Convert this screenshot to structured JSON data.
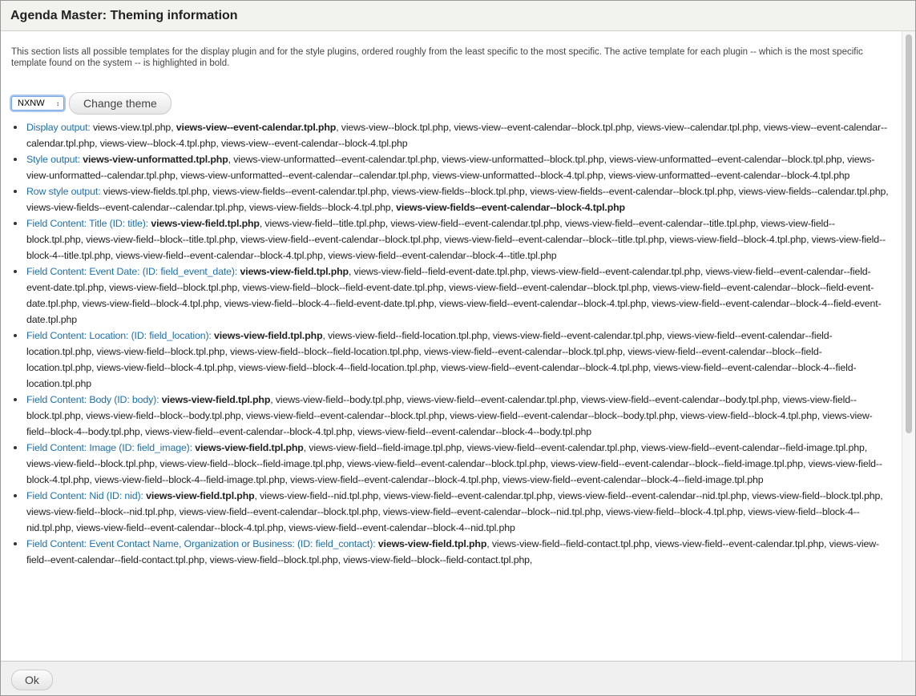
{
  "window": {
    "title": "Agenda Master: Theming information"
  },
  "description": "This section lists all possible templates for the display plugin and for the style plugins, ordered roughly from the least specific to the most specific. The active template for each plugin -- which is the most specific template found on the system -- is highlighted in bold.",
  "theme_select": {
    "value": "NXNW"
  },
  "change_theme_label": "Change theme",
  "ok_label": "Ok",
  "colors": {
    "link": "#1a6fb5",
    "titlebar": "#f2f2ee"
  },
  "items": [
    {
      "label": "Display output:",
      "templates": [
        {
          "name": "views-view.tpl.php"
        },
        {
          "name": "views-view--event-calendar.tpl.php",
          "active": true
        },
        {
          "name": "views-view--block.tpl.php"
        },
        {
          "name": "views-view--event-calendar--block.tpl.php"
        },
        {
          "name": "views-view--calendar.tpl.php"
        },
        {
          "name": "views-view--event-calendar--calendar.tpl.php"
        },
        {
          "name": "views-view--block-4.tpl.php"
        },
        {
          "name": "views-view--event-calendar--block-4.tpl.php"
        }
      ]
    },
    {
      "label": "Style output:",
      "templates": [
        {
          "name": "views-view-unformatted.tpl.php",
          "active": true
        },
        {
          "name": "views-view-unformatted--event-calendar.tpl.php"
        },
        {
          "name": "views-view-unformatted--block.tpl.php"
        },
        {
          "name": "views-view-unformatted--event-calendar--block.tpl.php"
        },
        {
          "name": "views-view-unformatted--calendar.tpl.php"
        },
        {
          "name": "views-view-unformatted--event-calendar--calendar.tpl.php"
        },
        {
          "name": "views-view-unformatted--block-4.tpl.php"
        },
        {
          "name": "views-view-unformatted--event-calendar--block-4.tpl.php"
        }
      ]
    },
    {
      "label": "Row style output:",
      "templates": [
        {
          "name": "views-view-fields.tpl.php"
        },
        {
          "name": "views-view-fields--event-calendar.tpl.php"
        },
        {
          "name": "views-view-fields--block.tpl.php"
        },
        {
          "name": "views-view-fields--event-calendar--block.tpl.php"
        },
        {
          "name": "views-view-fields--calendar.tpl.php"
        },
        {
          "name": "views-view-fields--event-calendar--calendar.tpl.php"
        },
        {
          "name": "views-view-fields--block-4.tpl.php"
        },
        {
          "name": "views-view-fields--event-calendar--block-4.tpl.php",
          "active": true
        }
      ]
    },
    {
      "label": "Field Content: Title (ID: title):",
      "templates": [
        {
          "name": "views-view-field.tpl.php",
          "active": true
        },
        {
          "name": "views-view-field--title.tpl.php"
        },
        {
          "name": "views-view-field--event-calendar.tpl.php"
        },
        {
          "name": "views-view-field--event-calendar--title.tpl.php"
        },
        {
          "name": "views-view-field--block.tpl.php"
        },
        {
          "name": "views-view-field--block--title.tpl.php"
        },
        {
          "name": "views-view-field--event-calendar--block.tpl.php"
        },
        {
          "name": "views-view-field--event-calendar--block--title.tpl.php"
        },
        {
          "name": "views-view-field--block-4.tpl.php"
        },
        {
          "name": "views-view-field--block-4--title.tpl.php"
        },
        {
          "name": "views-view-field--event-calendar--block-4.tpl.php"
        },
        {
          "name": "views-view-field--event-calendar--block-4--title.tpl.php"
        }
      ]
    },
    {
      "label": "Field Content: Event Date: (ID: field_event_date):",
      "templates": [
        {
          "name": "views-view-field.tpl.php",
          "active": true
        },
        {
          "name": "views-view-field--field-event-date.tpl.php"
        },
        {
          "name": "views-view-field--event-calendar.tpl.php"
        },
        {
          "name": "views-view-field--event-calendar--field-event-date.tpl.php"
        },
        {
          "name": "views-view-field--block.tpl.php"
        },
        {
          "name": "views-view-field--block--field-event-date.tpl.php"
        },
        {
          "name": "views-view-field--event-calendar--block.tpl.php"
        },
        {
          "name": "views-view-field--event-calendar--block--field-event-date.tpl.php"
        },
        {
          "name": "views-view-field--block-4.tpl.php"
        },
        {
          "name": "views-view-field--block-4--field-event-date.tpl.php"
        },
        {
          "name": "views-view-field--event-calendar--block-4.tpl.php"
        },
        {
          "name": "views-view-field--event-calendar--block-4--field-event-date.tpl.php"
        }
      ]
    },
    {
      "label": "Field Content: Location: (ID: field_location):",
      "templates": [
        {
          "name": "views-view-field.tpl.php",
          "active": true
        },
        {
          "name": "views-view-field--field-location.tpl.php"
        },
        {
          "name": "views-view-field--event-calendar.tpl.php"
        },
        {
          "name": "views-view-field--event-calendar--field-location.tpl.php"
        },
        {
          "name": "views-view-field--block.tpl.php"
        },
        {
          "name": "views-view-field--block--field-location.tpl.php"
        },
        {
          "name": "views-view-field--event-calendar--block.tpl.php"
        },
        {
          "name": "views-view-field--event-calendar--block--field-location.tpl.php"
        },
        {
          "name": "views-view-field--block-4.tpl.php"
        },
        {
          "name": "views-view-field--block-4--field-location.tpl.php"
        },
        {
          "name": "views-view-field--event-calendar--block-4.tpl.php"
        },
        {
          "name": "views-view-field--event-calendar--block-4--field-location.tpl.php"
        }
      ]
    },
    {
      "label": "Field Content: Body (ID: body):",
      "templates": [
        {
          "name": "views-view-field.tpl.php",
          "active": true
        },
        {
          "name": "views-view-field--body.tpl.php"
        },
        {
          "name": "views-view-field--event-calendar.tpl.php"
        },
        {
          "name": "views-view-field--event-calendar--body.tpl.php"
        },
        {
          "name": "views-view-field--block.tpl.php"
        },
        {
          "name": "views-view-field--block--body.tpl.php"
        },
        {
          "name": "views-view-field--event-calendar--block.tpl.php"
        },
        {
          "name": "views-view-field--event-calendar--block--body.tpl.php"
        },
        {
          "name": "views-view-field--block-4.tpl.php"
        },
        {
          "name": "views-view-field--block-4--body.tpl.php"
        },
        {
          "name": "views-view-field--event-calendar--block-4.tpl.php"
        },
        {
          "name": "views-view-field--event-calendar--block-4--body.tpl.php"
        }
      ]
    },
    {
      "label": "Field Content: Image (ID: field_image):",
      "templates": [
        {
          "name": "views-view-field.tpl.php",
          "active": true
        },
        {
          "name": "views-view-field--field-image.tpl.php"
        },
        {
          "name": "views-view-field--event-calendar.tpl.php"
        },
        {
          "name": "views-view-field--event-calendar--field-image.tpl.php"
        },
        {
          "name": "views-view-field--block.tpl.php"
        },
        {
          "name": "views-view-field--block--field-image.tpl.php"
        },
        {
          "name": "views-view-field--event-calendar--block.tpl.php"
        },
        {
          "name": "views-view-field--event-calendar--block--field-image.tpl.php"
        },
        {
          "name": "views-view-field--block-4.tpl.php"
        },
        {
          "name": "views-view-field--block-4--field-image.tpl.php"
        },
        {
          "name": "views-view-field--event-calendar--block-4.tpl.php"
        },
        {
          "name": "views-view-field--event-calendar--block-4--field-image.tpl.php"
        }
      ]
    },
    {
      "label": "Field Content: Nid (ID: nid):",
      "templates": [
        {
          "name": "views-view-field.tpl.php",
          "active": true
        },
        {
          "name": "views-view-field--nid.tpl.php"
        },
        {
          "name": "views-view-field--event-calendar.tpl.php"
        },
        {
          "name": "views-view-field--event-calendar--nid.tpl.php"
        },
        {
          "name": "views-view-field--block.tpl.php"
        },
        {
          "name": "views-view-field--block--nid.tpl.php"
        },
        {
          "name": "views-view-field--event-calendar--block.tpl.php"
        },
        {
          "name": "views-view-field--event-calendar--block--nid.tpl.php"
        },
        {
          "name": "views-view-field--block-4.tpl.php"
        },
        {
          "name": "views-view-field--block-4--nid.tpl.php"
        },
        {
          "name": "views-view-field--event-calendar--block-4.tpl.php"
        },
        {
          "name": "views-view-field--event-calendar--block-4--nid.tpl.php"
        }
      ]
    },
    {
      "label": "Field Content: Event Contact Name, Organization or Business: (ID: field_contact):",
      "templates": [
        {
          "name": "views-view-field.tpl.php",
          "active": true
        },
        {
          "name": "views-view-field--field-contact.tpl.php"
        },
        {
          "name": "views-view-field--event-calendar.tpl.php"
        },
        {
          "name": "views-view-field--event-calendar--field-contact.tpl.php"
        },
        {
          "name": "views-view-field--block.tpl.php"
        },
        {
          "name": "views-view-field--block--field-contact.tpl.php"
        }
      ]
    }
  ]
}
